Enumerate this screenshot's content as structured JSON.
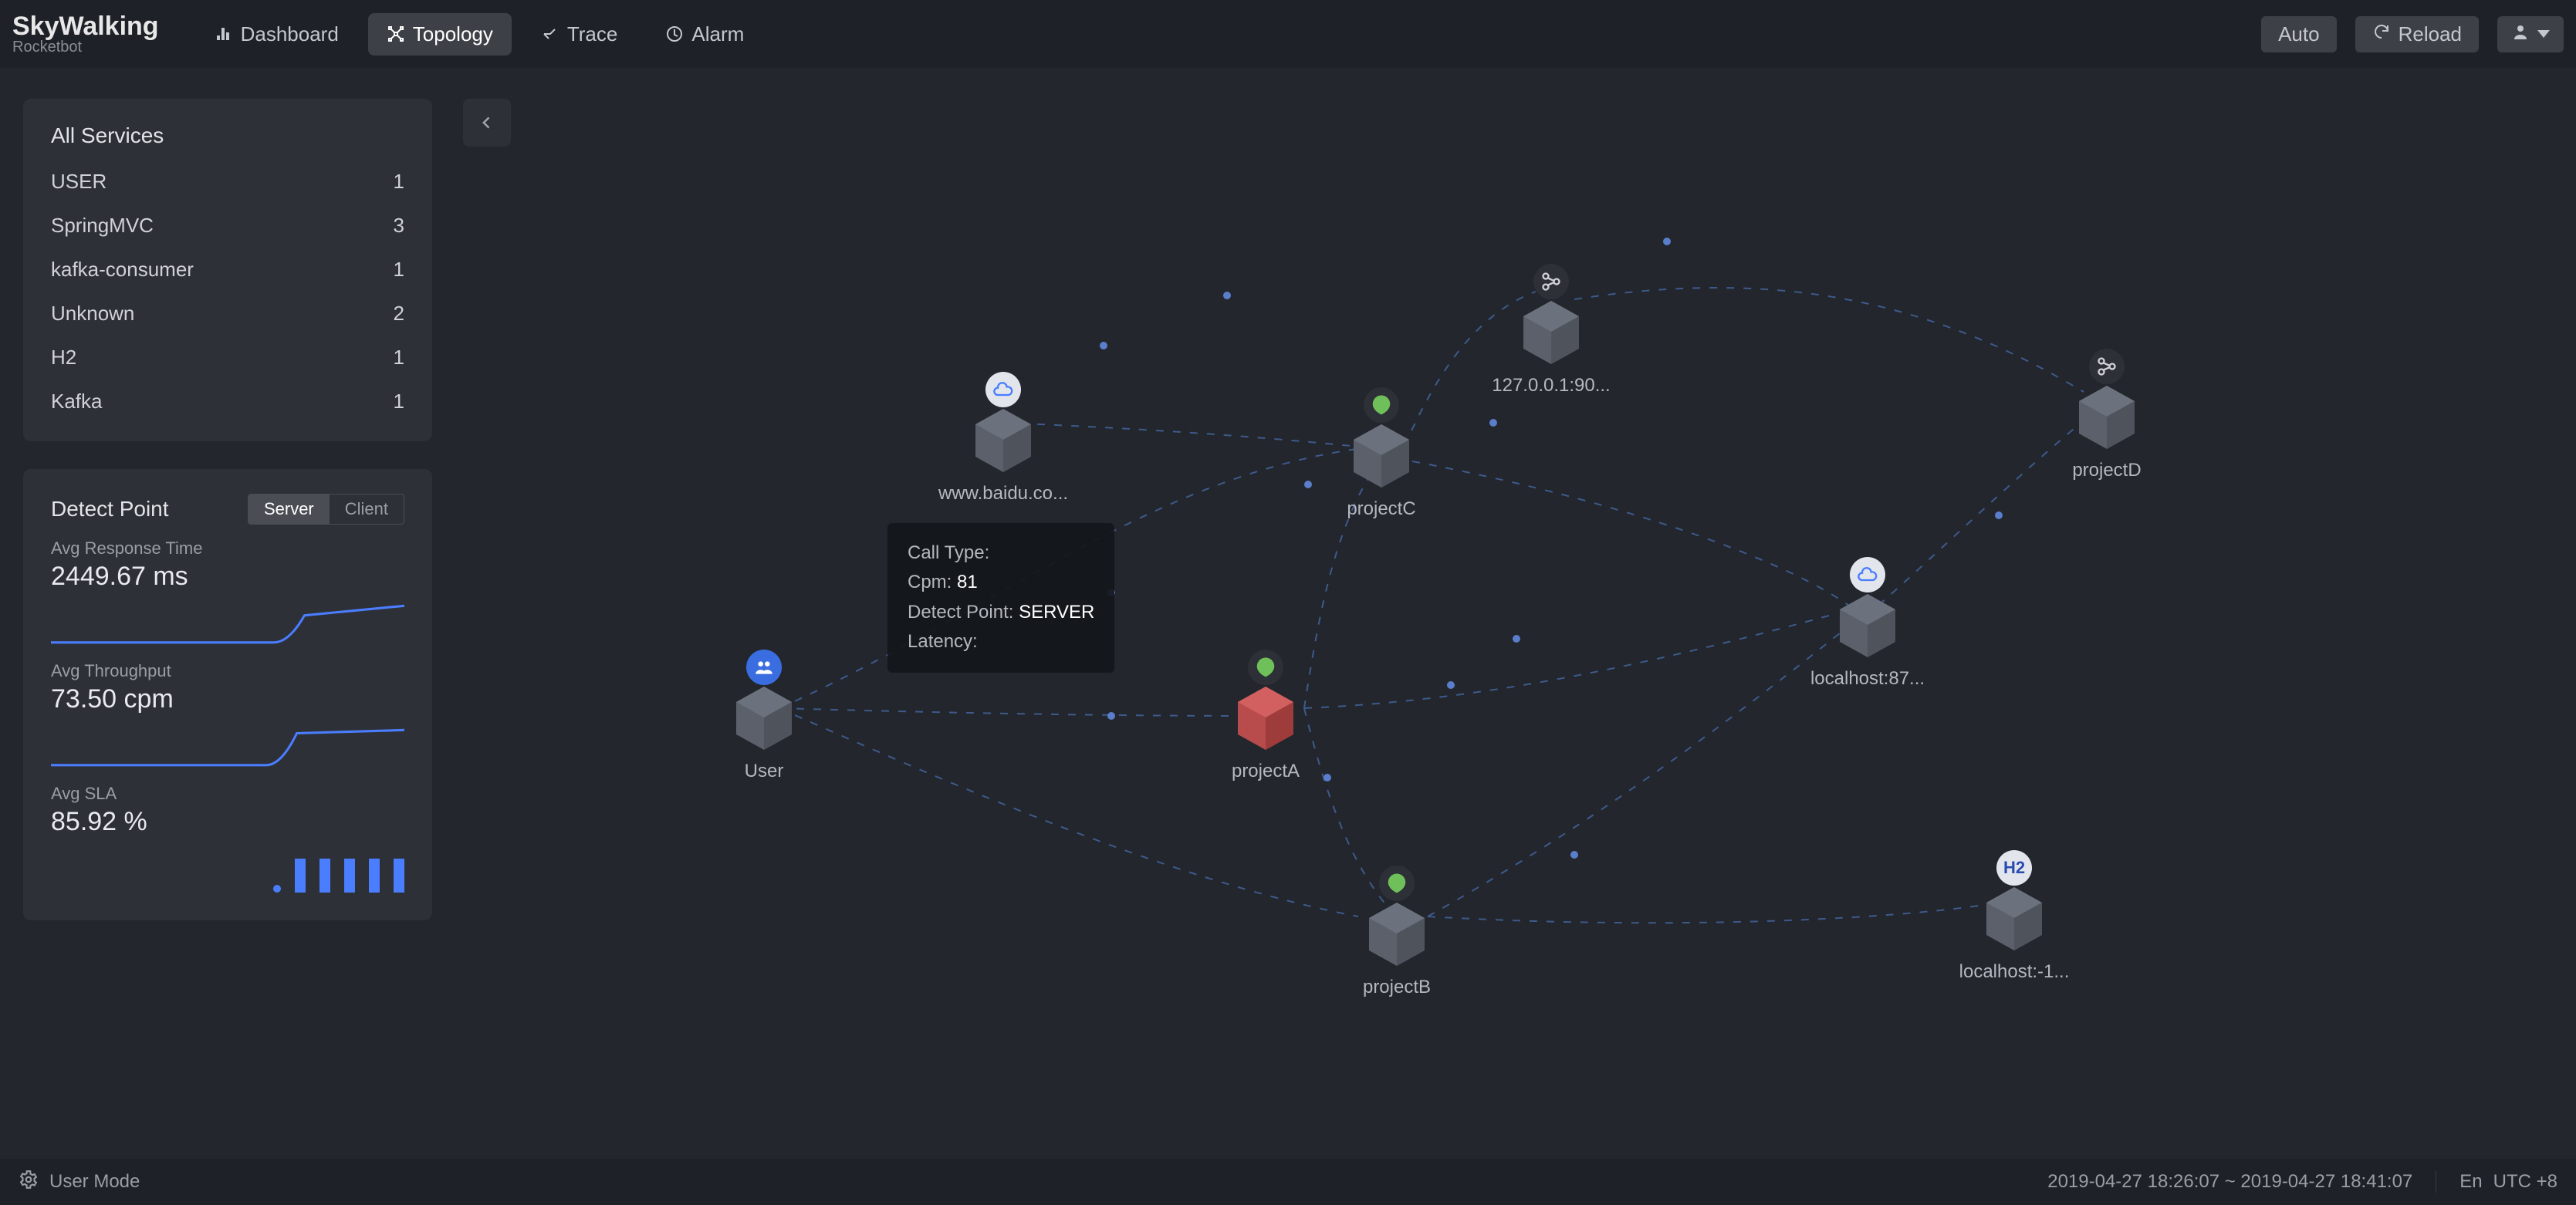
{
  "brand": {
    "name": "SkyWalking",
    "sub": "Rocketbot"
  },
  "nav": {
    "items": [
      {
        "label": "Dashboard"
      },
      {
        "label": "Topology"
      },
      {
        "label": "Trace"
      },
      {
        "label": "Alarm"
      }
    ],
    "active_index": 1
  },
  "header_actions": {
    "auto": "Auto",
    "reload": "Reload"
  },
  "service_panel": {
    "title": "All Services",
    "rows": [
      {
        "name": "USER",
        "count": "1"
      },
      {
        "name": "SpringMVC",
        "count": "3"
      },
      {
        "name": "kafka-consumer",
        "count": "1"
      },
      {
        "name": "Unknown",
        "count": "2"
      },
      {
        "name": "H2",
        "count": "1"
      },
      {
        "name": "Kafka",
        "count": "1"
      }
    ]
  },
  "detect_panel": {
    "title": "Detect Point",
    "segments": {
      "server": "Server",
      "client": "Client",
      "active": "server"
    },
    "response": {
      "label": "Avg Response Time",
      "value": "2449.67 ms"
    },
    "throughput": {
      "label": "Avg Throughput",
      "value": "73.50 cpm"
    },
    "sla": {
      "label": "Avg SLA",
      "value": "85.92 %"
    }
  },
  "tooltip": {
    "call_type_key": "Call Type:",
    "call_type_val": "",
    "cpm_key": "Cpm:",
    "cpm_val": "81",
    "dp_key": "Detect Point:",
    "dp_val": "SERVER",
    "latency_key": "Latency:",
    "latency_val": ""
  },
  "nodes": {
    "user": {
      "label": "User"
    },
    "baidu": {
      "label": "www.baidu.co..."
    },
    "projectA": {
      "label": "projectA"
    },
    "projectB": {
      "label": "projectB"
    },
    "projectC": {
      "label": "projectC"
    },
    "projectD": {
      "label": "projectD"
    },
    "kafka": {
      "label": "127.0.0.1:90..."
    },
    "lh87": {
      "label": "localhost:87..."
    },
    "lh_1": {
      "label": "localhost:-1..."
    }
  },
  "colors": {
    "accent": "#4a7dff",
    "node_red": "#d05a5a",
    "node_gray": "#5b606a",
    "edge": "#3d5a8c"
  },
  "footer": {
    "mode": "User Mode",
    "range": "2019-04-27 18:26:07 ~ 2019-04-27 18:41:07",
    "lang": "En",
    "tz": "UTC +8"
  }
}
